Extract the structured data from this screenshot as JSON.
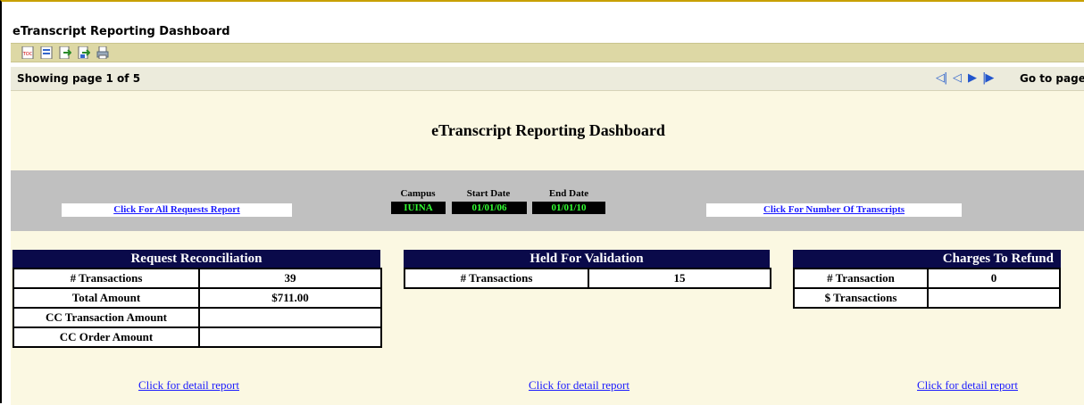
{
  "window": {
    "title": "eTranscript Reporting Dashboard"
  },
  "toolbar": {
    "icons": [
      "toc-icon",
      "document-map-icon",
      "export-icon",
      "export-to-icon",
      "print-icon"
    ]
  },
  "pager": {
    "showing": "Showing page  1  of  5",
    "goto_label": "Go to page"
  },
  "report": {
    "title": "eTranscript Reporting Dashboard",
    "all_requests_link": "Click For All Requests Report",
    "num_transcripts_link": "Click For Number Of Transcripts",
    "params": {
      "campus_label": "Campus",
      "campus_value": "IUINA",
      "start_label": "Start Date",
      "start_value": "01/01/06",
      "end_label": "End Date",
      "end_value": "01/01/10"
    }
  },
  "request_reconciliation": {
    "title": "Request Reconciliation",
    "rows": [
      {
        "label": "# Transactions",
        "value": "39"
      },
      {
        "label": "Total Amount",
        "value": "$711.00"
      },
      {
        "label": "CC Transaction Amount",
        "value": ""
      },
      {
        "label": "CC Order Amount",
        "value": ""
      }
    ],
    "detail_link": "Click for detail report"
  },
  "held_for_validation": {
    "title": "Held For Validation",
    "rows": [
      {
        "label": "# Transactions",
        "value": "15"
      }
    ],
    "detail_link": "Click for detail report"
  },
  "charges_to_refund": {
    "title": "Charges To Refund",
    "rows": [
      {
        "label": "# Transaction",
        "value": "0"
      },
      {
        "label": "$ Transactions",
        "value": ""
      }
    ],
    "detail_link": "Click for detail report"
  }
}
